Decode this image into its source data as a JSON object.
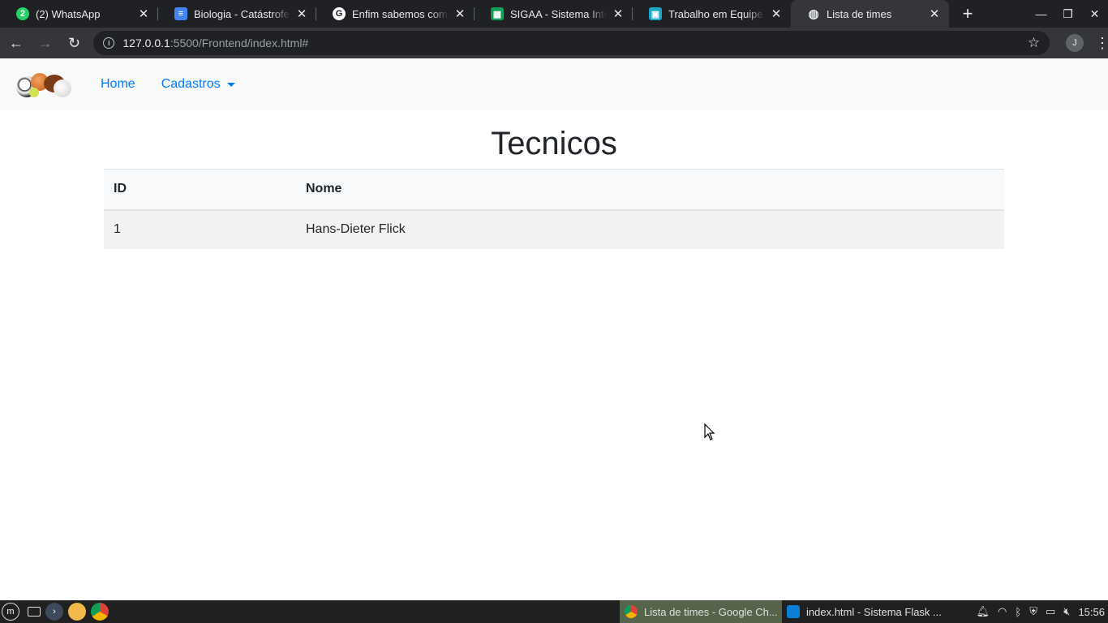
{
  "browser": {
    "tabs": [
      {
        "title": "(2) WhatsApp",
        "icon": "whatsapp-icon",
        "color": "#25d366",
        "glyph": "2"
      },
      {
        "title": "Biologia - Catástrofes",
        "icon": "google-docs-icon",
        "color": "#4285f4",
        "glyph": "≡"
      },
      {
        "title": "Enfim sabemos como s",
        "icon": "google-icon",
        "color": "#202124",
        "glyph": "G"
      },
      {
        "title": "SIGAA - Sistema Integr",
        "icon": "google-sheets-icon",
        "color": "#0f9d58",
        "glyph": "▦"
      },
      {
        "title": "Trabalho em Equipe -",
        "icon": "google-classroom-icon",
        "color": "#1ba8c4",
        "glyph": "▣"
      },
      {
        "title": "Lista de times",
        "icon": "globe-icon",
        "color": "#35363a",
        "glyph": "◍"
      }
    ],
    "close_glyph": "✕",
    "new_tab_glyph": "+",
    "address": {
      "host": "127.0.0.1",
      "path": ":5500/Frontend/index.html#"
    },
    "profile_initial": "J"
  },
  "app": {
    "nav": {
      "home": "Home",
      "cadastros": "Cadastros"
    },
    "title": "Tecnicos",
    "table": {
      "headers": [
        "ID",
        "Nome"
      ],
      "rows": [
        [
          "1",
          "Hans-Dieter Flick"
        ]
      ]
    }
  },
  "taskbar": {
    "windows": [
      {
        "title": "Lista de times - Google Ch...",
        "icon": "chrome-icon"
      },
      {
        "title": "index.html - Sistema Flask ...",
        "icon": "vscode-icon"
      }
    ],
    "clock": "15:56"
  }
}
